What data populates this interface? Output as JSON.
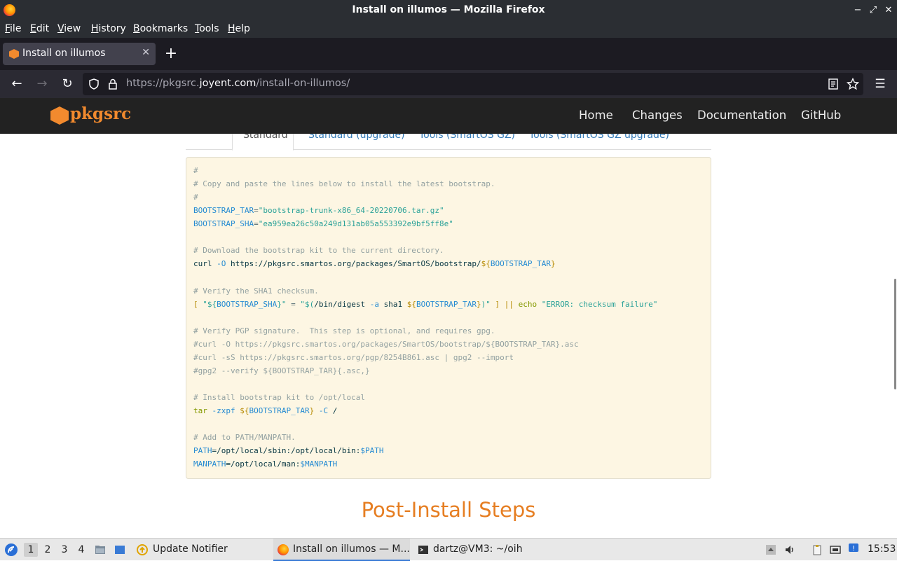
{
  "window": {
    "title": "Install on illumos — Mozilla Firefox",
    "controls": [
      "−",
      "⤢",
      "✕"
    ]
  },
  "menubar": [
    "File",
    "Edit",
    "View",
    "History",
    "Bookmarks",
    "Tools",
    "Help"
  ],
  "browser": {
    "tab_title": "Install on illumos",
    "url_prefix": "https://pkgsrc.",
    "url_domain": "joyent.com",
    "url_path": "/install-on-illumos/"
  },
  "site": {
    "logo": "pkgsrc",
    "nav": [
      "Home",
      "Changes",
      "Documentation",
      "GitHub"
    ]
  },
  "install_tabs": [
    "Standard",
    "Standard (upgrade)",
    "Tools (SmartOS GZ)",
    "Tools (SmartOS GZ upgrade)"
  ],
  "code": {
    "l01": "#",
    "l02": "# Copy and paste the lines below to install the latest bootstrap.",
    "l03": "#",
    "l04a": "BOOTSTRAP_TAR",
    "l04b": "=",
    "l04c": "\"bootstrap-trunk-x86_64-20220706.tar.gz\"",
    "l05a": "BOOTSTRAP_SHA",
    "l05b": "=",
    "l05c": "\"ea959ea26c50a249d131ab05a553392e9bf5ff8e\"",
    "l07": "# Download the bootstrap kit to the current directory.",
    "l08a": "curl ",
    "l08b": "-O",
    "l08c": " https://pkgsrc.smartos.org/packages/SmartOS/bootstrap/",
    "l08d": "${",
    "l08e": "BOOTSTRAP_TAR",
    "l08f": "}",
    "l10": "# Verify the SHA1 checksum.",
    "l11a": "[ ",
    "l11b": "\"${",
    "l11c": "BOOTSTRAP_SHA",
    "l11d": "}\"",
    "l11e": " = ",
    "l11f": "\"$(",
    "l11g": "/bin/digest ",
    "l11h": "-a",
    "l11i": " sha1 ",
    "l11j": "${",
    "l11k": "BOOTSTRAP_TAR",
    "l11l": "}",
    "l11m": ")\"",
    "l11n": " ] || ",
    "l11o": "echo",
    "l11p": " \"ERROR: checksum failure\"",
    "l13": "# Verify PGP signature.  This step is optional, and requires gpg.",
    "l14": "#curl -O https://pkgsrc.smartos.org/packages/SmartOS/bootstrap/${BOOTSTRAP_TAR}.asc",
    "l15": "#curl -sS https://pkgsrc.smartos.org/pgp/8254B861.asc | gpg2 --import",
    "l16": "#gpg2 --verify ${BOOTSTRAP_TAR}{.asc,}",
    "l18": "# Install bootstrap kit to /opt/local",
    "l19a": "tar ",
    "l19b": "-zxpf",
    "l19c": " ${",
    "l19d": "BOOTSTRAP_TAR",
    "l19e": "}",
    "l19f": " -C",
    "l19g": " /",
    "l21": "# Add to PATH/MANPATH.",
    "l22a": "PATH",
    "l22b": "=/opt/local/sbin:/opt/local/bin:",
    "l22c": "$PATH",
    "l23a": "MANPATH",
    "l23b": "=/opt/local/man:",
    "l23c": "$MANPATH"
  },
  "heading": "Post-Install Steps",
  "taskbar": {
    "workspaces": [
      "1",
      "2",
      "3",
      "4"
    ],
    "tasks": [
      "Update Notifier",
      "Install on illumos — M...",
      "dartz@VM3: ~/oih"
    ],
    "clock": "15:53"
  }
}
